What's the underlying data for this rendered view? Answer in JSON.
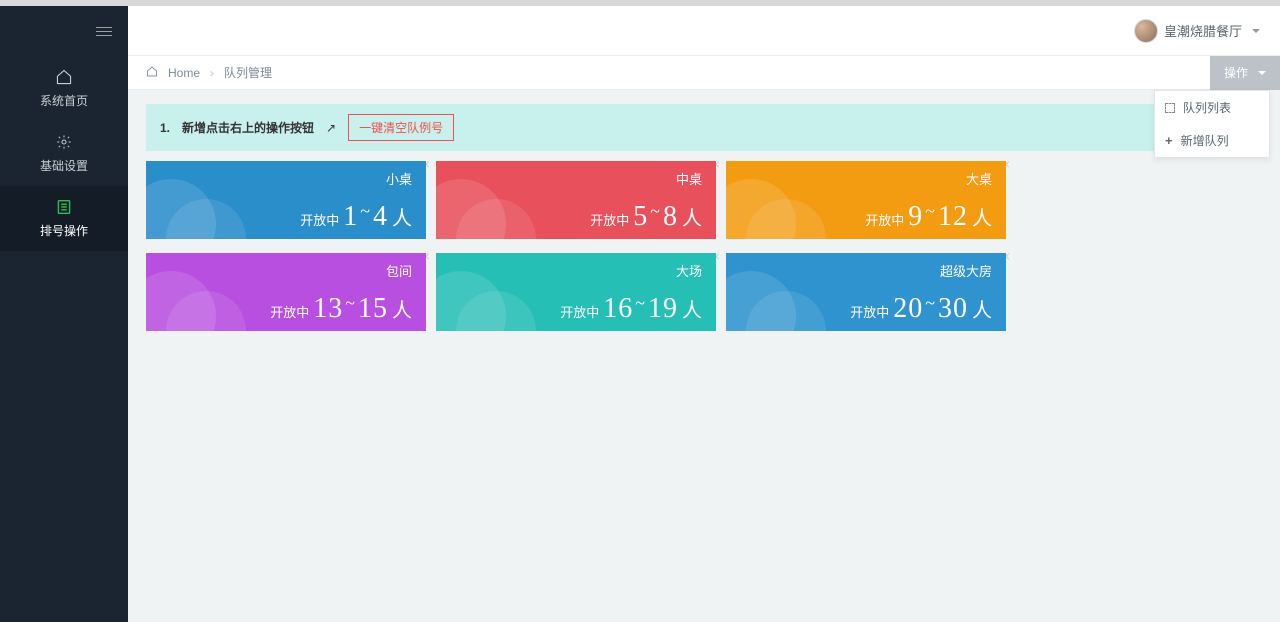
{
  "header": {
    "user_name": "皇潮烧腊餐厅"
  },
  "sidebar": {
    "items": [
      {
        "label": "系统首页",
        "icon": "home"
      },
      {
        "label": "基础设置",
        "icon": "gear"
      },
      {
        "label": "排号操作",
        "icon": "list"
      }
    ]
  },
  "breadcrumb": {
    "home": "Home",
    "page": "队列管理"
  },
  "action_button": {
    "label": "操作"
  },
  "dropdown": {
    "item1": "队列列表",
    "item2": "新增队列"
  },
  "notice": {
    "prefix": "1.",
    "text": "新增点击右上的操作按钮",
    "clear_btn": "一键清空队例号"
  },
  "cards": [
    {
      "title": "小桌",
      "status": "开放中",
      "min": "1",
      "max": "4",
      "suffix": "人",
      "color": "c-blue"
    },
    {
      "title": "中桌",
      "status": "开放中",
      "min": "5",
      "max": "8",
      "suffix": "人",
      "color": "c-red"
    },
    {
      "title": "大桌",
      "status": "开放中",
      "min": "9",
      "max": "12",
      "suffix": "人",
      "color": "c-orange"
    },
    {
      "title": "包间",
      "status": "开放中",
      "min": "13",
      "max": "15",
      "suffix": "人",
      "color": "c-purple"
    },
    {
      "title": "大场",
      "status": "开放中",
      "min": "16",
      "max": "19",
      "suffix": "人",
      "color": "c-teal"
    },
    {
      "title": "超级大房",
      "status": "开放中",
      "min": "20",
      "max": "30",
      "suffix": "人",
      "color": "c-blue2"
    }
  ]
}
